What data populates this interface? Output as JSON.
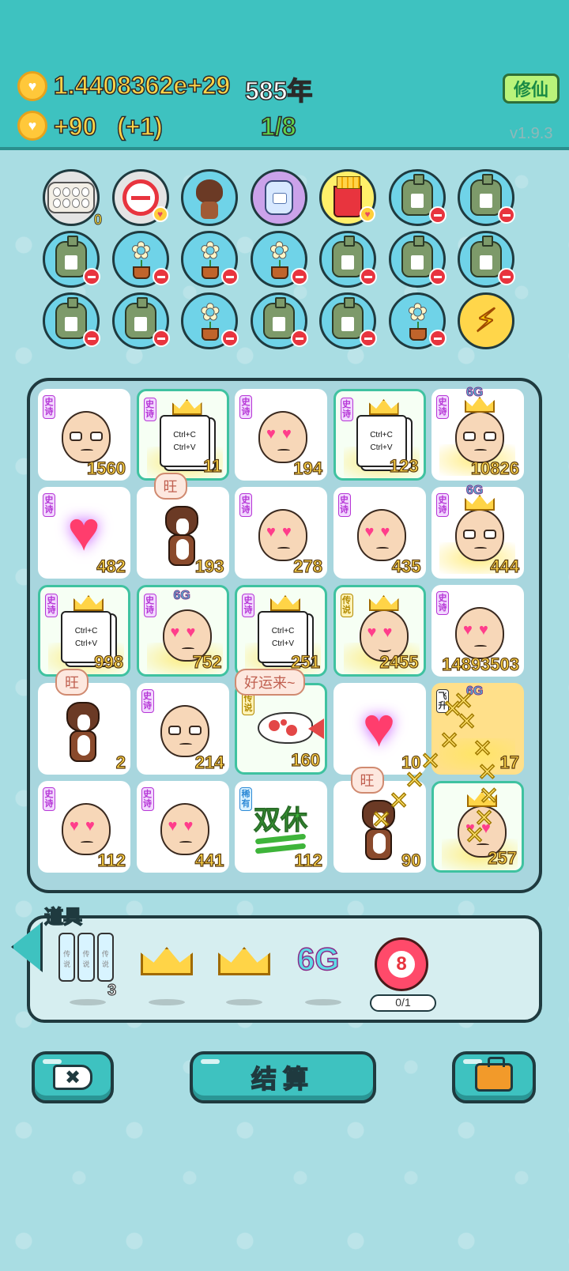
{
  "header": {
    "coins": "1.4408362e+29",
    "years": "585年",
    "income": "+90",
    "income_bonus": "(+1)",
    "progress": "1/8",
    "xiuxian_label": "修仙",
    "version": "v1.9.3"
  },
  "inventory": {
    "rows": [
      [
        {
          "icon": "egg-tray-icon",
          "count": "0"
        },
        {
          "icon": "no-sign-icon"
        },
        {
          "icon": "dog-icon"
        },
        {
          "icon": "jar-icon"
        },
        {
          "icon": "fries-icon"
        },
        {
          "icon": "bag-icon"
        },
        {
          "icon": "bag-icon"
        }
      ],
      [
        {
          "icon": "bag-icon"
        },
        {
          "icon": "flower-icon"
        },
        {
          "icon": "flower-icon"
        },
        {
          "icon": "flower-icon"
        },
        {
          "icon": "bag-icon"
        },
        {
          "icon": "bag-icon"
        },
        {
          "icon": "bag-icon"
        }
      ],
      [
        {
          "icon": "bag-icon"
        },
        {
          "icon": "bag-icon"
        },
        {
          "icon": "flower-icon"
        },
        {
          "icon": "bag-icon"
        },
        {
          "icon": "bag-icon"
        },
        {
          "icon": "flower-icon"
        },
        {
          "icon": "lightning-icon"
        }
      ]
    ]
  },
  "board": {
    "tags": {
      "epic": "史诗",
      "legend": "传说",
      "rare": "稀有",
      "fly": "飞升"
    },
    "cells": [
      {
        "row": 0,
        "col": 0,
        "type": "glasses-face",
        "tag": "epic",
        "value": "1560"
      },
      {
        "row": 0,
        "col": 1,
        "type": "copy-paste-doc",
        "tag": "epic",
        "value": "11",
        "crown": true,
        "framed": true
      },
      {
        "row": 0,
        "col": 2,
        "type": "heart-eyes-face",
        "tag": "epic",
        "value": "194"
      },
      {
        "row": 0,
        "col": 3,
        "type": "copy-paste-doc",
        "tag": "epic",
        "value": "123",
        "crown": true,
        "framed": true
      },
      {
        "row": 0,
        "col": 4,
        "type": "glasses-face",
        "tag": "epic",
        "value": "10826",
        "crown": true,
        "six_g": true
      },
      {
        "row": 1,
        "col": 0,
        "type": "heart",
        "tag": "epic",
        "value": "482"
      },
      {
        "row": 1,
        "col": 1,
        "type": "dog",
        "value": "193",
        "bubble": "旺"
      },
      {
        "row": 1,
        "col": 2,
        "type": "heart-eyes-face",
        "tag": "epic",
        "value": "278"
      },
      {
        "row": 1,
        "col": 3,
        "type": "heart-eyes-face",
        "tag": "epic",
        "value": "435"
      },
      {
        "row": 1,
        "col": 4,
        "type": "glasses-face",
        "tag": "epic",
        "value": "444",
        "crown": true,
        "six_g": true
      },
      {
        "row": 2,
        "col": 0,
        "type": "copy-paste-doc",
        "tag": "epic",
        "value": "998",
        "crown": true,
        "framed": true
      },
      {
        "row": 2,
        "col": 1,
        "type": "heart-eyes-face",
        "tag": "epic",
        "value": "752",
        "six_g": true,
        "framed": true
      },
      {
        "row": 2,
        "col": 2,
        "type": "copy-paste-doc",
        "tag": "epic",
        "value": "251",
        "crown": true,
        "framed": true
      },
      {
        "row": 2,
        "col": 3,
        "type": "heart-eyes-face-smile",
        "tag": "legend",
        "value": "2455",
        "crown": true,
        "framed": true
      },
      {
        "row": 2,
        "col": 4,
        "type": "heart-eyes-face",
        "tag": "epic",
        "value": "14893503"
      },
      {
        "row": 3,
        "col": 0,
        "type": "dog",
        "value": "2",
        "bubble": "旺"
      },
      {
        "row": 3,
        "col": 1,
        "type": "glasses-face",
        "tag": "epic",
        "value": "214"
      },
      {
        "row": 3,
        "col": 2,
        "type": "koi",
        "tag": "legend",
        "value": "160",
        "bubble": "好运来~",
        "framed": true
      },
      {
        "row": 3,
        "col": 3,
        "type": "heart",
        "value": "10"
      },
      {
        "row": 3,
        "col": 4,
        "type": "fly-up",
        "tag": "fly",
        "value": "17",
        "six_g": true
      },
      {
        "row": 4,
        "col": 0,
        "type": "heart-eyes-face",
        "tag": "epic",
        "value": "112"
      },
      {
        "row": 4,
        "col": 1,
        "type": "heart-eyes-face",
        "tag": "epic",
        "value": "441"
      },
      {
        "row": 4,
        "col": 2,
        "type": "double-rest",
        "tag": "rare",
        "value": "112",
        "text": "双休"
      },
      {
        "row": 4,
        "col": 3,
        "type": "dog",
        "value": "90",
        "bubble": "旺"
      },
      {
        "row": 4,
        "col": 4,
        "type": "heart-eyes-face",
        "value": "257",
        "crown": true,
        "framed": true
      }
    ]
  },
  "tools": {
    "title": "道具",
    "cards_count": "3",
    "cards_label": "传说",
    "six_g_label": "6G",
    "target_value": "8",
    "target_progress": "0/1"
  },
  "doc_text": {
    "line1": "Ctrl+C",
    "line2": "Ctrl+V"
  },
  "bottom": {
    "settle_label": "结算",
    "close_glyph": "✖"
  },
  "colors": {
    "header_bg": "#3ec2c0",
    "page_bg": "#a9dde3",
    "gold_text": "#ffd447",
    "green_text": "#61d34a"
  }
}
